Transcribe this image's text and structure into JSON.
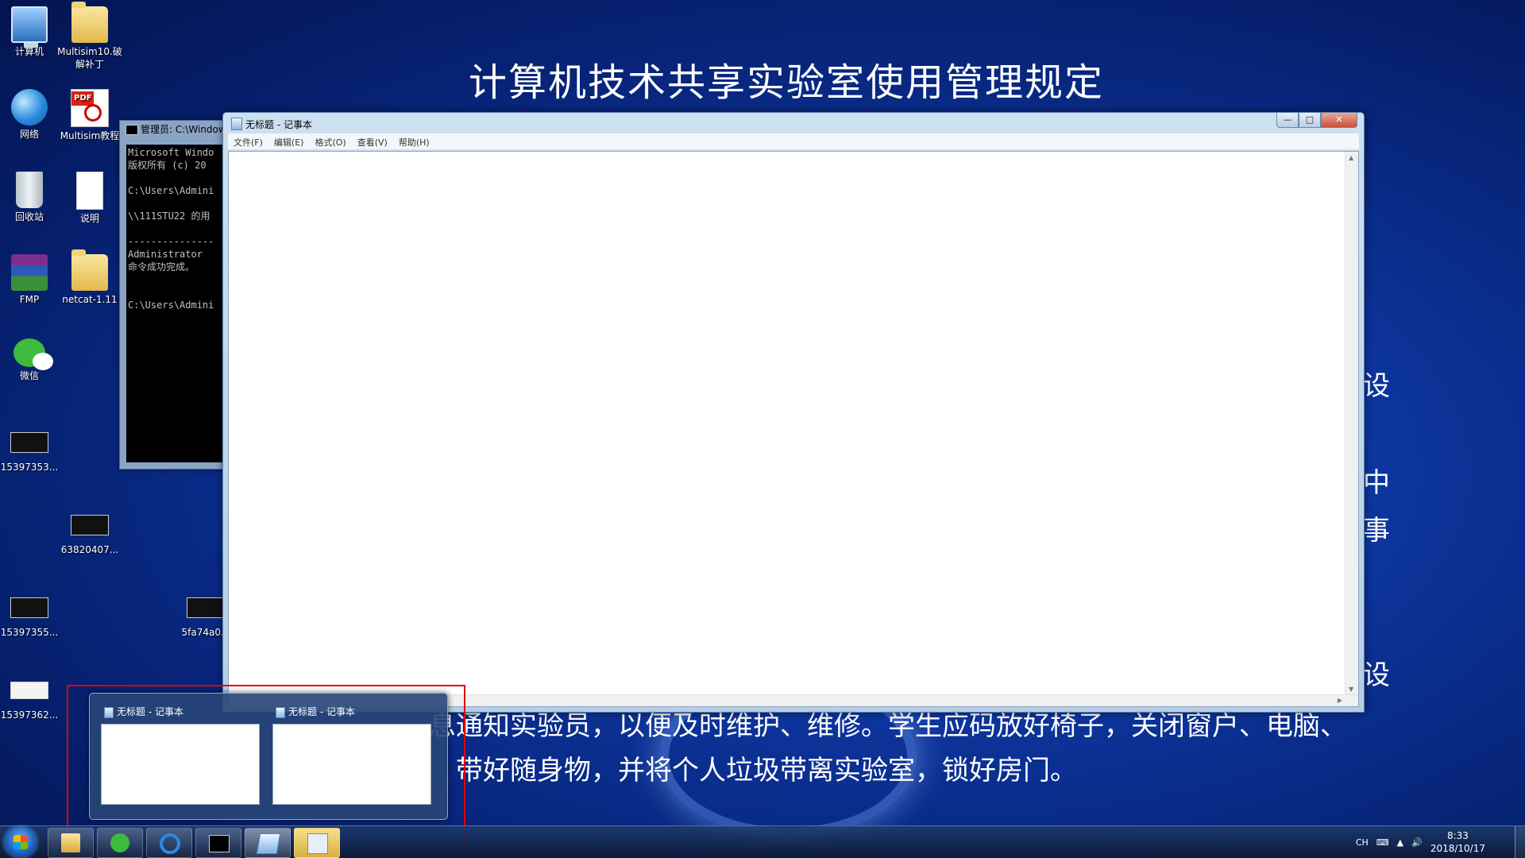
{
  "wallpaper": {
    "title": "计算机技术共享实验室使用管理规定",
    "line1": "息通知实验员，以便及时维护、维修。学生应码放好椅子，关闭窗户、电脑、",
    "line2": "带好随身物，并将个人垃圾带离实验室，锁好房门。",
    "frag1": "设",
    "frag2": "中",
    "frag3": "事",
    "frag4": "设"
  },
  "desktop_icons": [
    {
      "label": "计算机",
      "icon": "computer-icon"
    },
    {
      "label": "Multisim10.破解补丁",
      "icon": "folder-icon"
    },
    {
      "label": "网络",
      "icon": "network-icon"
    },
    {
      "label": "Multisim教程",
      "icon": "pdf-icon"
    },
    {
      "label": "回收站",
      "icon": "recycle-bin-icon"
    },
    {
      "label": "说明",
      "icon": "document-icon"
    },
    {
      "label": "FMP",
      "icon": "archive-icon"
    },
    {
      "label": "netcat-1.11",
      "icon": "folder-icon"
    },
    {
      "label": "微信",
      "icon": "wechat-icon"
    },
    {
      "label": "15397353...",
      "icon": "screenshot-icon"
    },
    {
      "label": "63820407...",
      "icon": "screenshot-icon"
    },
    {
      "label": "15397355...",
      "icon": "screenshot-icon"
    },
    {
      "label": "5fa74a0...",
      "icon": "screenshot-icon"
    },
    {
      "label": "15397362...",
      "icon": "screenshot-icon"
    }
  ],
  "cmd_window": {
    "title": "管理员: C:\\Windows",
    "lines": "Microsoft Windo\n版权所有 (c) 20\n\nC:\\Users\\Admini\n\n\\\\111STU22 的用\n\n---------------\nAdministrator\n命令成功完成。\n\n\nC:\\Users\\Admini"
  },
  "notepad": {
    "title": "无标题 - 记事本",
    "menus": [
      "文件(F)",
      "编辑(E)",
      "格式(O)",
      "查看(V)",
      "帮助(H)"
    ],
    "minimize": "—",
    "maximize": "□",
    "close": "✕"
  },
  "preview": {
    "items": [
      {
        "title": "无标题 - 记事本"
      },
      {
        "title": "无标题 - 记事本"
      }
    ]
  },
  "taskbar": {
    "apps": [
      "explorer-icon",
      "wechat-icon",
      "ie-icon",
      "cmd-icon",
      "notepad-icon",
      "calculator-icon"
    ],
    "lang": "CH",
    "time": "8:33",
    "date": "2018/10/17"
  }
}
